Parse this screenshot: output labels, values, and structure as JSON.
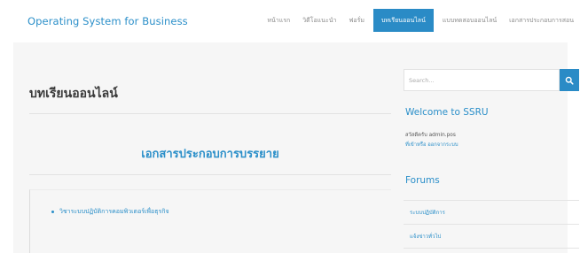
{
  "header": {
    "site_title": "Operating System for Business",
    "nav": [
      {
        "label": "หน้าแรก",
        "active": false
      },
      {
        "label": "วิดีโอแนะนำ",
        "active": false
      },
      {
        "label": "ฟอรั่ม",
        "active": false
      },
      {
        "label": "บทเรียนออนไลน์",
        "active": true
      },
      {
        "label": "แบบทดสอบออนไลน์",
        "active": false
      },
      {
        "label": "เอกสารประกอบการสอน",
        "active": false
      }
    ]
  },
  "main": {
    "page_title": "บทเรียนออนไลน์",
    "section_heading": "เอกสารประกอบการบรรยาย",
    "content_items": [
      "วิชาระบบปฏิบัติการคอมพิวเตอร์เพื่อธุรกิจ"
    ]
  },
  "sidebar": {
    "search": {
      "placeholder": "Search..."
    },
    "welcome": {
      "title": "Welcome to SSRU",
      "line1": "สวัสดีครับ admin.pos",
      "line2": "ที่เข้าหรือ ออกจากระบบ"
    },
    "forums": {
      "title": "Forums",
      "items": [
        "ระบบปฏิบัติการ",
        "แจ้งข่าวทั่วไป"
      ]
    }
  },
  "colors": {
    "accent": "#2a8bc6",
    "background": "#f6f6f6"
  }
}
